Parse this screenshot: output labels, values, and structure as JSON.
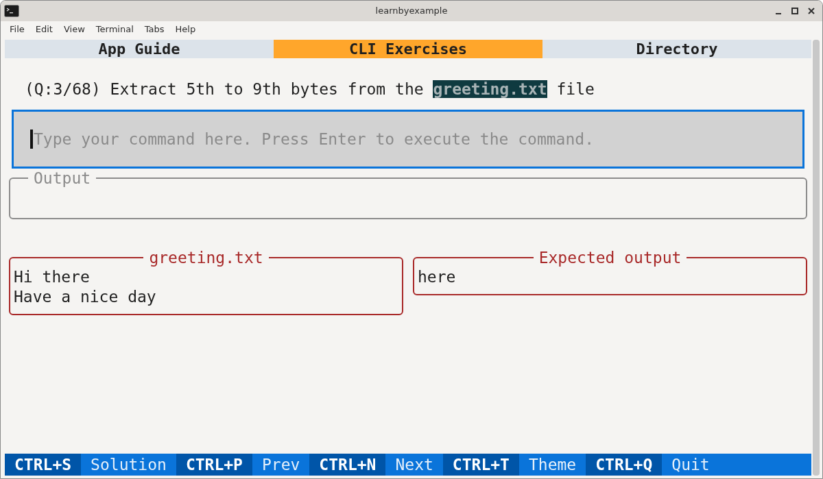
{
  "window": {
    "title": "learnbyexample"
  },
  "menu": [
    "File",
    "Edit",
    "View",
    "Terminal",
    "Tabs",
    "Help"
  ],
  "tabs": [
    {
      "label": "App Guide",
      "selected": false
    },
    {
      "label": "CLI Exercises",
      "selected": true
    },
    {
      "label": "Directory",
      "selected": false
    }
  ],
  "question": {
    "prefix": "(Q:3/68) Extract 5th to 9th bytes from the ",
    "filename": "greeting.txt",
    "suffix": " file"
  },
  "command": {
    "placeholder": "Type your command here. Press Enter to execute the command."
  },
  "output": {
    "title": "Output"
  },
  "panels": [
    {
      "title": "greeting.txt",
      "lines": [
        "Hi there",
        "Have a nice day"
      ]
    },
    {
      "title": "Expected output",
      "lines": [
        "here"
      ]
    }
  ],
  "shortcuts": [
    {
      "key": "CTRL+S",
      "label": "Solution"
    },
    {
      "key": "CTRL+P",
      "label": "Prev"
    },
    {
      "key": "CTRL+N",
      "label": "Next"
    },
    {
      "key": "CTRL+T",
      "label": "Theme"
    },
    {
      "key": "CTRL+Q",
      "label": "Quit"
    }
  ]
}
